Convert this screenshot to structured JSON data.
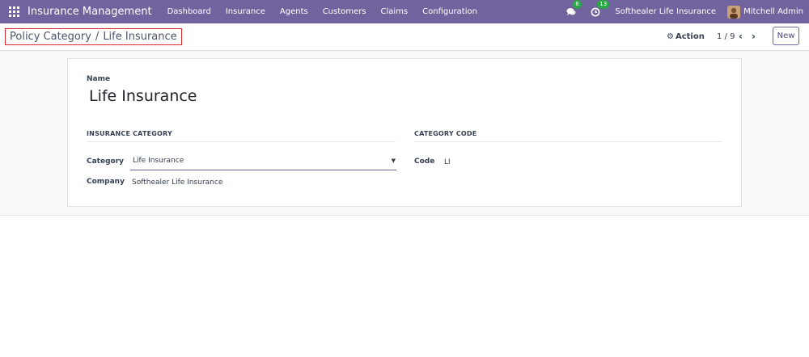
{
  "navbar": {
    "brand": "Insurance Management",
    "menu": [
      "Dashboard",
      "Insurance",
      "Agents",
      "Customers",
      "Claims",
      "Configuration"
    ],
    "messages_count": "6",
    "activities_count": "13",
    "company": "Softhealer Life Insurance",
    "user": "Mitchell Admin"
  },
  "control_panel": {
    "breadcrumb_parent": "Policy Category",
    "breadcrumb_separator": "/",
    "breadcrumb_current": "Life Insurance",
    "action_label": "Action",
    "pager": "1 / 9",
    "new_label": "New"
  },
  "form": {
    "name_label": "Name",
    "name_value": "Life Insurance",
    "section_left": "INSURANCE CATEGORY",
    "section_right": "CATEGORY CODE",
    "category_label": "Category",
    "category_value": "Life Insurance",
    "company_label": "Company",
    "company_value": "Softhealer Life Insurance",
    "code_label": "Code",
    "code_value": "LI"
  },
  "colors": {
    "navbar": "#71639e",
    "badge": "#28a745",
    "breadcrumb_highlight": "#d9252b"
  },
  "icons": [
    "apps-grid-icon",
    "chat-icon",
    "clock-icon",
    "gear-icon",
    "chevron-left-icon",
    "chevron-right-icon",
    "caret-down-icon"
  ]
}
